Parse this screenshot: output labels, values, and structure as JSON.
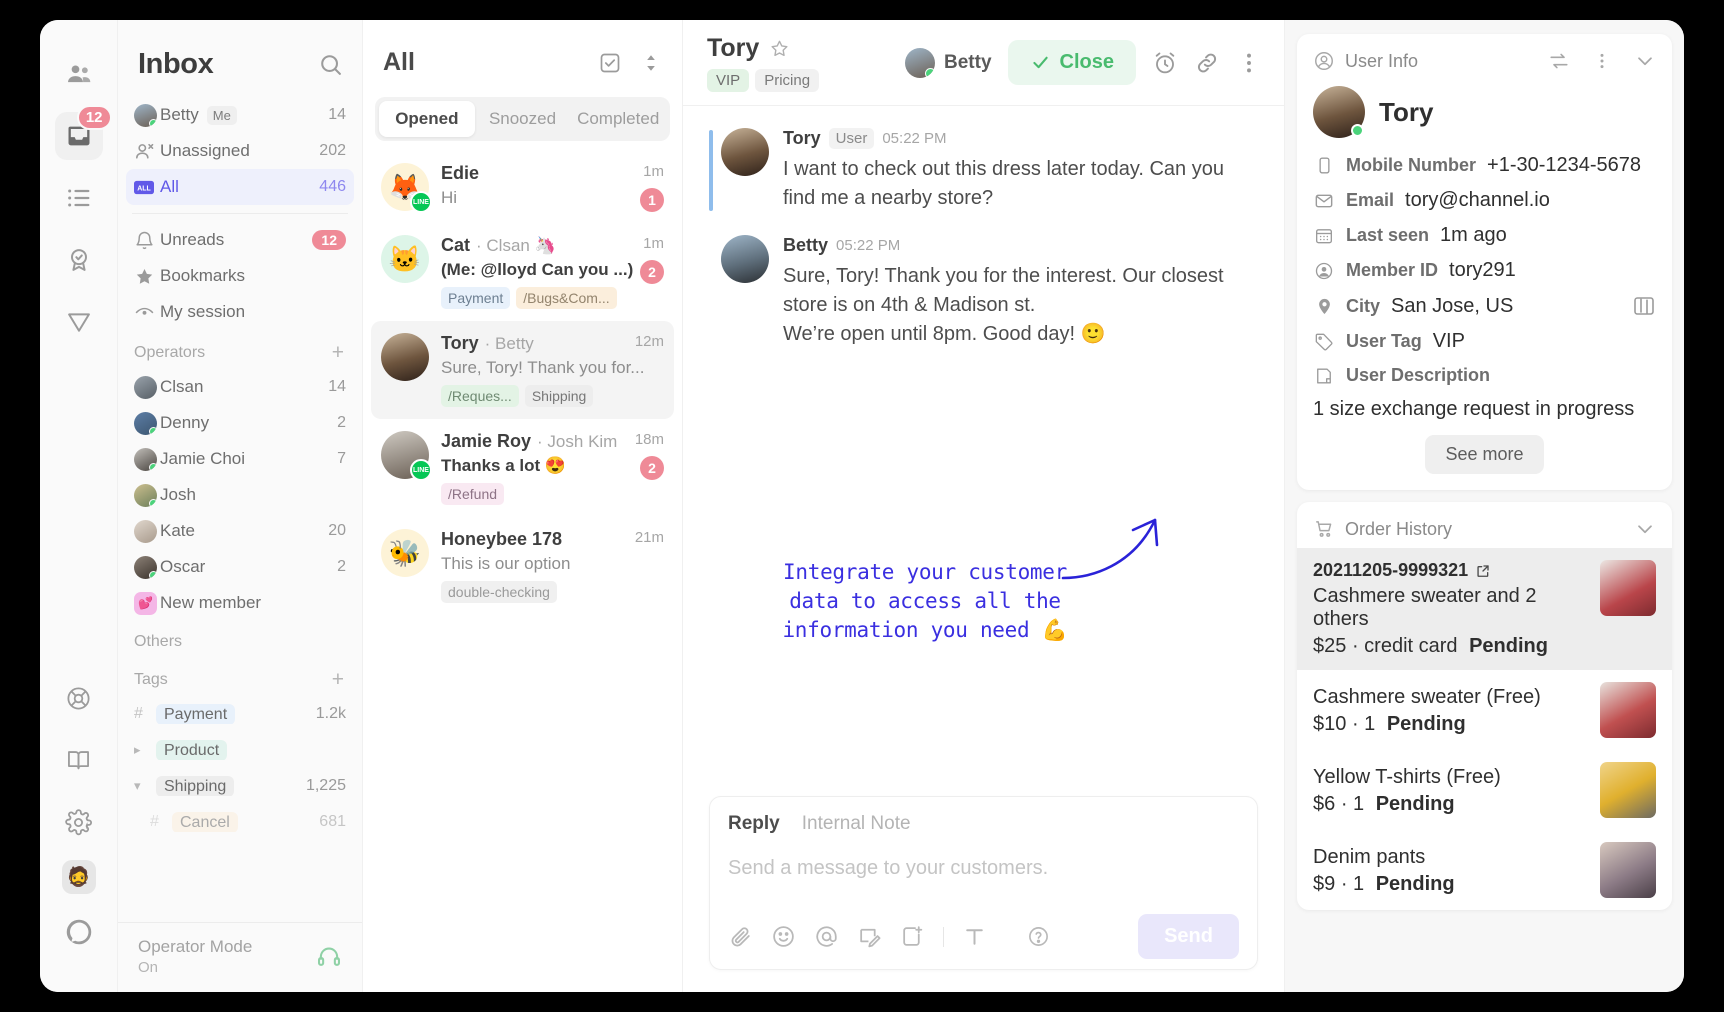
{
  "rail": {
    "items": [
      {
        "name": "contacts",
        "icon": "people-icon",
        "badge": null,
        "active": false
      },
      {
        "name": "inbox",
        "icon": "inbox-icon",
        "badge": "12",
        "active": true
      },
      {
        "name": "tasks",
        "icon": "list-icon",
        "badge": null,
        "active": false
      },
      {
        "name": "stats",
        "icon": "award-icon",
        "badge": null,
        "active": false
      },
      {
        "name": "marketing",
        "icon": "send-icon",
        "badge": null,
        "active": false
      }
    ],
    "bottom": [
      {
        "name": "support",
        "icon": "lifebuoy-icon"
      },
      {
        "name": "docs",
        "icon": "book-icon"
      },
      {
        "name": "settings",
        "icon": "gear-icon"
      },
      {
        "name": "profile",
        "icon": "avatar-glasses"
      },
      {
        "name": "channel",
        "icon": "channel-logo-icon"
      }
    ]
  },
  "inbox": {
    "title": "Inbox",
    "search_icon": "search-icon",
    "primary": [
      {
        "label": "Betty",
        "chip": "Me",
        "count": "14",
        "icon": "avatar-betty",
        "selected": false
      },
      {
        "label": "Unassigned",
        "chip": "",
        "count": "202",
        "icon": "user-x-icon",
        "selected": false
      },
      {
        "label": "All",
        "chip": "",
        "count": "446",
        "icon": "all-icon",
        "selected": true
      }
    ],
    "secondary": [
      {
        "label": "Unreads",
        "count": "12",
        "icon": "bell-icon",
        "badge": true
      },
      {
        "label": "Bookmarks",
        "count": "",
        "icon": "star-icon",
        "badge": false
      },
      {
        "label": "My session",
        "count": "",
        "icon": "eye-icon",
        "badge": false
      }
    ],
    "operators_header": "Operators",
    "operators": [
      {
        "label": "Clsan",
        "count": "14",
        "online": false
      },
      {
        "label": "Denny",
        "count": "2",
        "online": true
      },
      {
        "label": "Jamie Choi",
        "count": "7",
        "online": true
      },
      {
        "label": "Josh",
        "count": "",
        "online": true
      },
      {
        "label": "Kate",
        "count": "20",
        "online": false
      },
      {
        "label": "Oscar",
        "count": "2",
        "online": true
      },
      {
        "label": "New member",
        "count": "",
        "online": false
      }
    ],
    "others_header": "Others",
    "tags_header": "Tags",
    "tags": [
      {
        "label": "Payment",
        "count": "1.2k",
        "marker": "#",
        "color": "#e8f1fb",
        "text": "#6a6a6a"
      },
      {
        "label": "Product",
        "count": "",
        "marker": ">",
        "color": "#e3f3ee",
        "text": "#6a6a6a"
      },
      {
        "label": "Shipping",
        "count": "1,225",
        "marker": "v",
        "color": "#eeeeee",
        "text": "#6a6a6a"
      },
      {
        "label": "Cancel",
        "count": "681",
        "marker": "#",
        "color": "#fbeedc",
        "text": "#6a6a6a"
      }
    ],
    "operator_mode_label": "Operator Mode",
    "operator_mode_state": "On",
    "operator_mode_icon": "headset-icon"
  },
  "convo_list": {
    "title": "All",
    "select_icon": "checkbox-icon",
    "sort_icon": "sort-icon",
    "tabs": [
      {
        "label": "Opened",
        "active": true
      },
      {
        "label": "Snoozed",
        "active": false
      },
      {
        "label": "Completed",
        "active": false
      }
    ],
    "items": [
      {
        "name": "Edie",
        "operator": "",
        "preview": "Hi",
        "preview_bold": false,
        "time": "1m",
        "unread": "1",
        "tags": [],
        "avatar_emoji": "🦊",
        "avatar_bg": "#fdf3d7",
        "channel": "LINE"
      },
      {
        "name": "Cat",
        "operator": "· Clsan 🦄",
        "preview": "(Me: @lloyd Can you ...)",
        "preview_bold": true,
        "time": "1m",
        "unread": "2",
        "tags": [
          {
            "label": "Payment",
            "color": "#e8f1fb",
            "text": "#6d7f91"
          },
          {
            "label": "/Bugs&Com...",
            "color": "#fbeedc",
            "text": "#93846d"
          }
        ],
        "avatar_emoji": "🐱",
        "avatar_bg": "#ddf5e8",
        "channel": ""
      },
      {
        "name": "Tory",
        "operator": "· Betty",
        "preview": "Sure, Tory! Thank you for...",
        "preview_bold": false,
        "time": "12m",
        "unread": "",
        "selected": true,
        "tags": [
          {
            "label": "/Reques...",
            "color": "#e3f3e5",
            "text": "#6f8a72"
          },
          {
            "label": "Shipping",
            "color": "#ededed",
            "text": "#777777"
          }
        ],
        "avatar_emoji": "",
        "avatar_bg": "#cdbba4",
        "channel": ""
      },
      {
        "name": "Jamie Roy",
        "operator": "· Josh Kim",
        "preview": "Thanks a lot 😍",
        "preview_bold": true,
        "time": "18m",
        "unread": "2",
        "tags": [
          {
            "label": "/Refund",
            "color": "#f9e9f2",
            "text": "#8e7386"
          }
        ],
        "avatar_emoji": "",
        "avatar_bg": "#b9b2a8",
        "channel": "LINE"
      },
      {
        "name": "Honeybee 178",
        "operator": "",
        "preview": "This is our option",
        "preview_bold": false,
        "time": "21m",
        "unread": "",
        "tags": [
          {
            "label": "double-checking",
            "color": "#f0f0f0",
            "text": "#9a9a9a"
          }
        ],
        "avatar_emoji": "🐝",
        "avatar_bg": "#fdf3d7",
        "channel": ""
      }
    ]
  },
  "chat": {
    "title": "Tory",
    "star_icon": "star-outline-icon",
    "tags": [
      {
        "label": "VIP",
        "color": "#e3f3e5",
        "text": "#6e6e6e"
      },
      {
        "label": "Pricing",
        "color": "#f1f1f1",
        "text": "#7a7a7a"
      }
    ],
    "assignee": "Betty",
    "close_label": "Close",
    "close_icon": "check-icon",
    "header_icons": [
      "alarm-icon",
      "link-icon",
      "more-vertical-icon"
    ],
    "messages": [
      {
        "sender": "Tory",
        "role": "User",
        "time": "05:22 PM",
        "text": "I want to check out this dress later today. Can you find me a nearby store?",
        "highlight": true
      },
      {
        "sender": "Betty",
        "role": "",
        "time": "05:22 PM",
        "text": "Sure, Tory! Thank you for the interest. Our closest store is on 4th & Madison st.\nWe’re open until 8pm. Good day! 🙂",
        "highlight": false
      }
    ],
    "annotation": "Integrate your customer\ndata to access all the\ninformation you need 💪",
    "annotation_color": "#3a2fe0",
    "reply": {
      "tabs": [
        {
          "label": "Reply",
          "active": true
        },
        {
          "label": "Internal Note",
          "active": false
        }
      ],
      "placeholder": "Send a message to your customers.",
      "tools": [
        "attachment-icon",
        "emoji-icon",
        "mention-icon",
        "snippet-icon",
        "template-icon",
        "format-text-icon",
        "help-icon"
      ],
      "send_label": "Send"
    }
  },
  "right_panel": {
    "user_info": {
      "header": "User Info",
      "header_icon": "user-circle-icon",
      "actions": [
        "swap-icon",
        "more-vertical-icon",
        "chevron-down-icon"
      ],
      "name": "Tory",
      "fields": [
        {
          "icon": "mobile-icon",
          "key": "Mobile Number",
          "value": "+1-30-1234-5678"
        },
        {
          "icon": "mail-icon",
          "key": "Email",
          "value": "tory@channel.io"
        },
        {
          "icon": "calendar-icon",
          "key": "Last seen",
          "value": "1m ago"
        },
        {
          "icon": "user-circle-icon",
          "key": "Member ID",
          "value": "tory291"
        },
        {
          "icon": "pin-icon",
          "key": "City",
          "value": "San Jose, US",
          "trailing_icon": "map-icon"
        },
        {
          "icon": "tag-icon",
          "key": "User Tag",
          "value": "VIP"
        },
        {
          "icon": "note-icon",
          "key": "User Description",
          "value": ""
        }
      ],
      "description": "1 size exchange request in progress",
      "see_more": "See more"
    },
    "order_history": {
      "header": "Order History",
      "header_icon": "cart-icon",
      "collapse_icon": "chevron-down-icon",
      "orders": [
        {
          "id": "20211205-9999321",
          "external_icon": "external-link-icon",
          "name": "Cashmere sweater and 2 others",
          "price": "$25",
          "qty": "credit card",
          "status": "Pending",
          "highlight": true,
          "thumb": "#b9454a"
        },
        {
          "id": "",
          "name": "Cashmere sweater (Free)",
          "price": "$10",
          "qty": "1",
          "status": "Pending",
          "highlight": false,
          "thumb": "#c05050"
        },
        {
          "id": "",
          "name": "Yellow T-shirts (Free)",
          "price": "$6",
          "qty": "1",
          "status": "Pending",
          "highlight": false,
          "thumb": "#e0b02e"
        },
        {
          "id": "",
          "name": "Denim pants",
          "price": "$9",
          "qty": "1",
          "status": "Pending",
          "highlight": false,
          "thumb": "#8c7b86"
        }
      ]
    }
  }
}
